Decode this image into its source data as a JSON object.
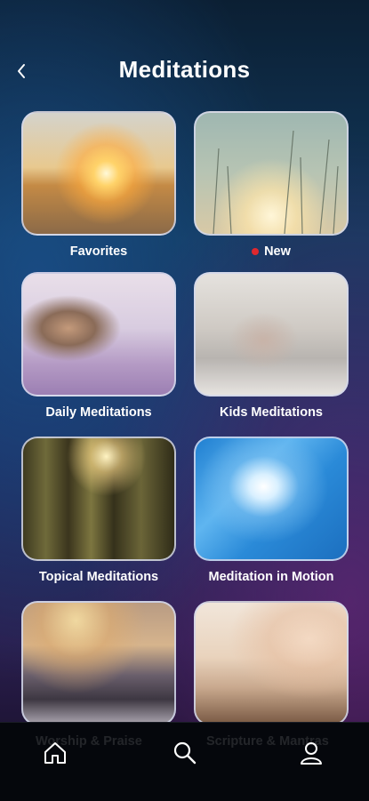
{
  "header": {
    "title": "Meditations",
    "back_icon": "chevron-left-icon"
  },
  "tiles": [
    {
      "label": "Favorites",
      "image": "sunset-hand-image"
    },
    {
      "label": "New",
      "badge_color": "#e0282e",
      "image": "grass-sunrise-image"
    },
    {
      "label": "Daily Meditations",
      "image": "woman-lavender-field-image"
    },
    {
      "label": "Kids Meditations",
      "image": "mother-child-couch-image"
    },
    {
      "label": "Topical Meditations",
      "image": "forest-sunlight-image"
    },
    {
      "label": "Meditation in Motion",
      "image": "blue-swirl-water-image"
    },
    {
      "label": "Worship & Praise",
      "image": "snowy-mountain-image"
    },
    {
      "label": "Scripture & Mantras",
      "image": "hand-open-book-image"
    }
  ],
  "tabbar": {
    "items": [
      {
        "name": "home",
        "icon": "home-icon"
      },
      {
        "name": "search",
        "icon": "search-icon"
      },
      {
        "name": "profile",
        "icon": "user-icon"
      }
    ]
  },
  "colors": {
    "tile_border": "#d2d7eb",
    "new_badge": "#e0282e",
    "tabbar_bg": "#05070c"
  }
}
